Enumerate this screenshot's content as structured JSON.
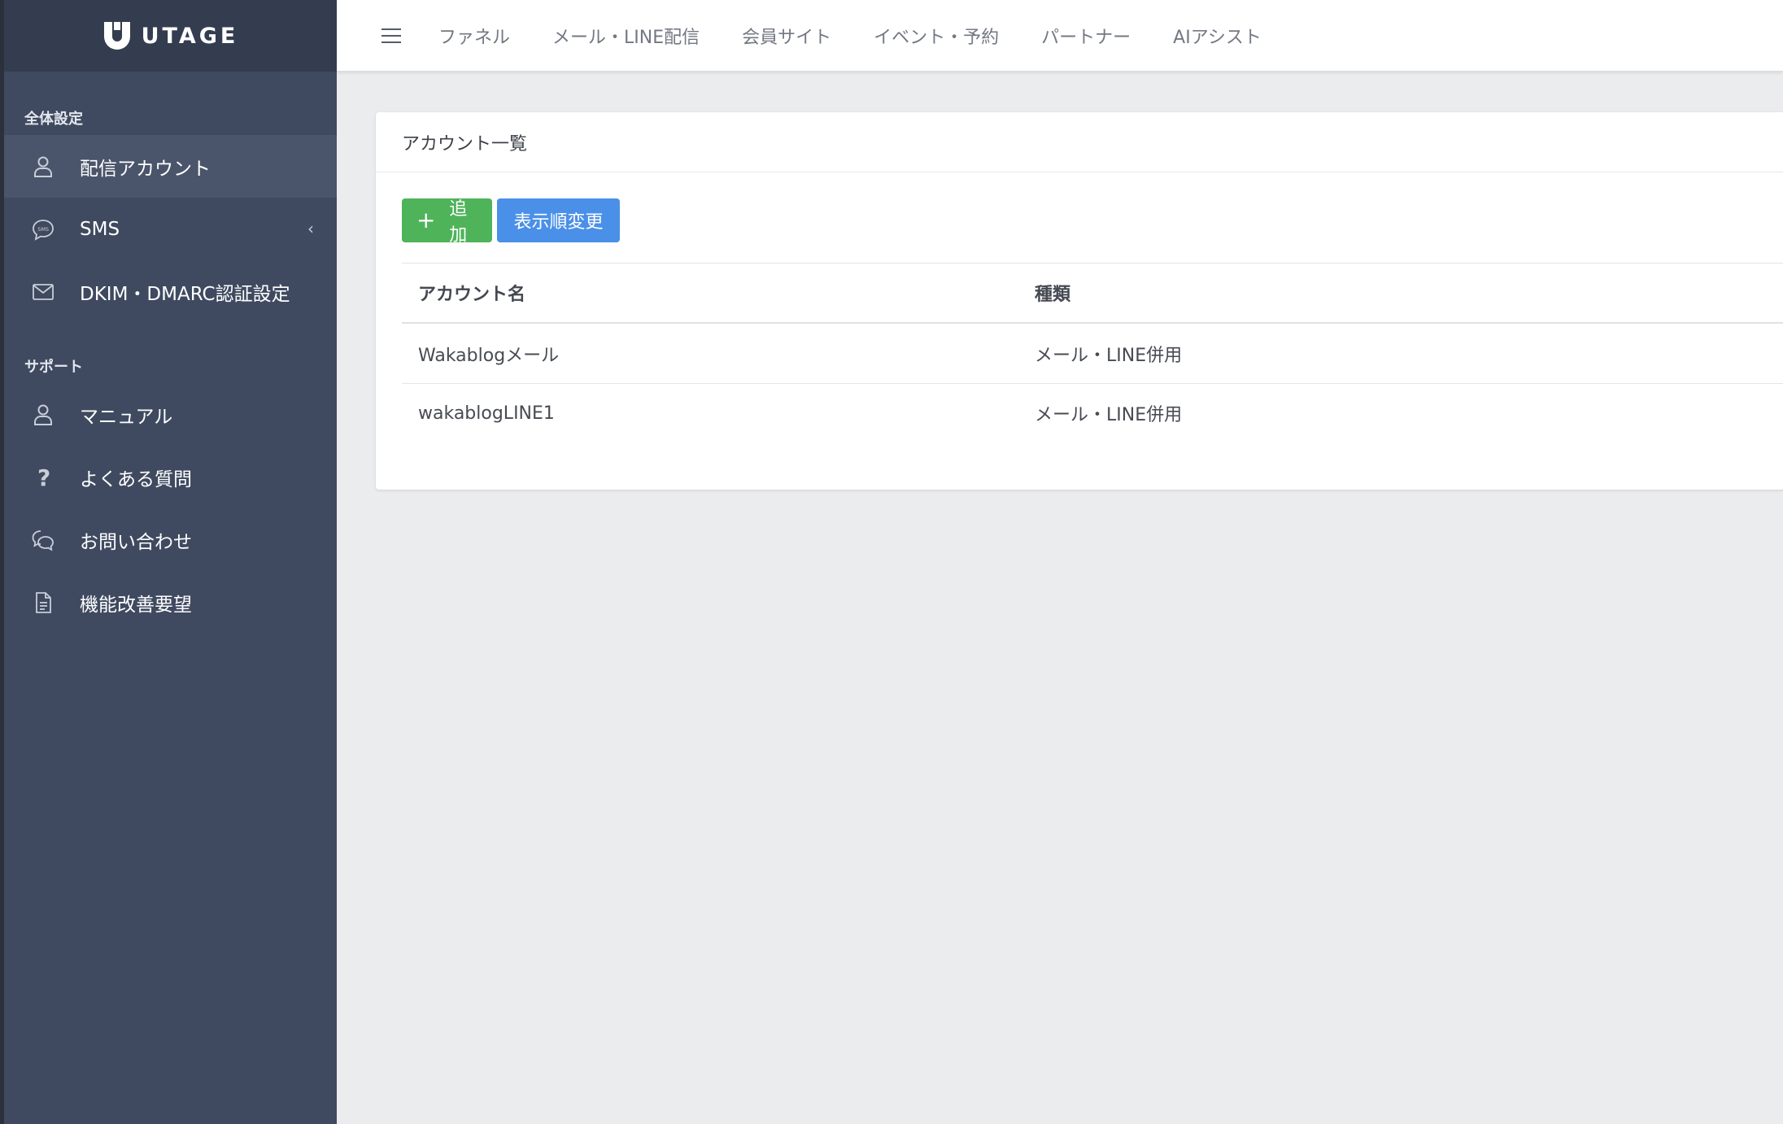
{
  "brand": {
    "name": "UTAGE"
  },
  "sidebar": {
    "sections": [
      {
        "label": "全体設定",
        "items": [
          {
            "label": "配信アカウント",
            "icon": "user-icon",
            "active": true
          },
          {
            "label": "SMS",
            "icon": "sms-icon",
            "has_submenu": true
          },
          {
            "label": "DKIM・DMARC認証設定",
            "icon": "envelope-icon"
          }
        ]
      },
      {
        "label": "サポート",
        "items": [
          {
            "label": "マニュアル",
            "icon": "user-icon"
          },
          {
            "label": "よくある質問",
            "icon": "question-icon"
          },
          {
            "label": "お問い合わせ",
            "icon": "chat-icon"
          },
          {
            "label": "機能改善要望",
            "icon": "document-icon"
          }
        ]
      }
    ],
    "submenu_caret": "‹"
  },
  "topnav": {
    "links": [
      "ファネル",
      "メール・LINE配信",
      "会員サイト",
      "イベント・予約",
      "パートナー",
      "AIアシスト"
    ]
  },
  "card": {
    "title": "アカウント一覧",
    "add_button": "追加",
    "add_button_icon": "+",
    "order_button": "表示順変更",
    "table": {
      "headers": [
        "アカウント名",
        "種類"
      ],
      "rows": [
        [
          "Wakablogメール",
          "メール・LINE併用"
        ],
        [
          "wakablogLINE1",
          "メール・LINE併用"
        ]
      ]
    }
  },
  "colors": {
    "sidebar_bg": "#3f4a60",
    "sidebar_active": "#4a556b",
    "add_button": "#4fb35a",
    "order_button": "#4a90e8"
  }
}
